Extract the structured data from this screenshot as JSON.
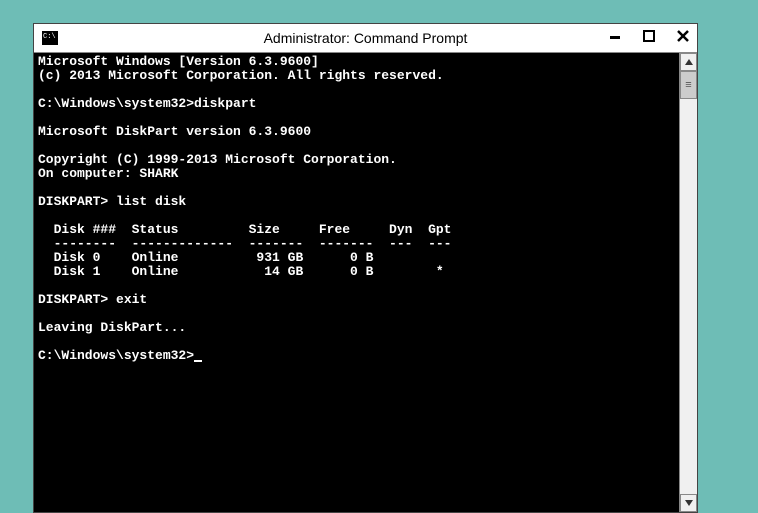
{
  "window": {
    "title": "Administrator: Command Prompt"
  },
  "terminal": {
    "lines": {
      "l0": "Microsoft Windows [Version 6.3.9600]",
      "l1": "(c) 2013 Microsoft Corporation. All rights reserved.",
      "l2": "",
      "l3": "C:\\Windows\\system32>diskpart",
      "l4": "",
      "l5": "Microsoft DiskPart version 6.3.9600",
      "l6": "",
      "l7": "Copyright (C) 1999-2013 Microsoft Corporation.",
      "l8": "On computer: SHARK",
      "l9": "",
      "l10": "DISKPART> list disk",
      "l11": "",
      "l12": "  Disk ###  Status         Size     Free     Dyn  Gpt",
      "l13": "  --------  -------------  -------  -------  ---  ---",
      "l14": "  Disk 0    Online          931 GB      0 B",
      "l15": "  Disk 1    Online           14 GB      0 B        *",
      "l16": "",
      "l17": "DISKPART> exit",
      "l18": "",
      "l19": "Leaving DiskPart...",
      "l20": "",
      "l21": "C:\\Windows\\system32>"
    }
  },
  "chart_data": {
    "type": "table",
    "title": "DISKPART list disk",
    "columns": [
      "Disk ###",
      "Status",
      "Size",
      "Free",
      "Dyn",
      "Gpt"
    ],
    "rows": [
      {
        "Disk ###": "Disk 0",
        "Status": "Online",
        "Size": "931 GB",
        "Free": "0 B",
        "Dyn": "",
        "Gpt": ""
      },
      {
        "Disk ###": "Disk 1",
        "Status": "Online",
        "Size": "14 GB",
        "Free": "0 B",
        "Dyn": "",
        "Gpt": "*"
      }
    ]
  }
}
